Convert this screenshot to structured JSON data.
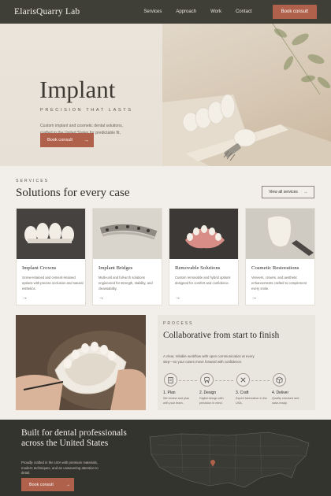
{
  "nav": {
    "brand": "ElarisQuarry Lab",
    "links": [
      "Services",
      "Approach",
      "Work",
      "Contact"
    ],
    "cta": "Book consult"
  },
  "hero": {
    "title": "Implant",
    "kicker": "PRECISION THAT LASTS",
    "description": "Custom implant and cosmetic dental solutions, crafted in the United States for predictable fit, function, and esthetics.",
    "cta": "Book consult"
  },
  "services": {
    "kicker": "SERVICES",
    "title": "Solutions for every case",
    "view_all": "View all services",
    "cards": [
      {
        "title": "Implant Crowns",
        "desc": "Screw-retained and cement-retained options with precise occlusion and natural esthetics."
      },
      {
        "title": "Implant Bridges",
        "desc": "Multi-unit and full-arch solutions engineered for strength, stability, and cleansability."
      },
      {
        "title": "Removable Solutions",
        "desc": "Custom removable and hybrid options designed for comfort and confidence."
      },
      {
        "title": "Cosmetic Restorations",
        "desc": "Veneers, crowns, and aesthetic enhancements crafted to complement every smile."
      }
    ]
  },
  "process": {
    "kicker": "PROCESS",
    "title": "Collaborative from start to finish",
    "description": "A clear, reliable workflow with open communication at every step—so your cases move forward with confidence.",
    "steps": [
      {
        "label": "1. Plan",
        "desc": "We review and plan with your team."
      },
      {
        "label": "2. Design",
        "desc": "Digital design with precision in mind."
      },
      {
        "label": "3. Craft",
        "desc": "Expert fabrication in the USA."
      },
      {
        "label": "4. Deliver",
        "desc": "Quality checked and case-ready."
      }
    ]
  },
  "band": {
    "title": "Built for dental professionals across the United States",
    "description": "Proudly crafted in the USA with premium materials, modern techniques, and an unwavering attention to detail.",
    "cta": "Book consult"
  },
  "colors": {
    "accent": "#b0614b",
    "dark": "#3f3f38",
    "background": "#f2efeb"
  }
}
